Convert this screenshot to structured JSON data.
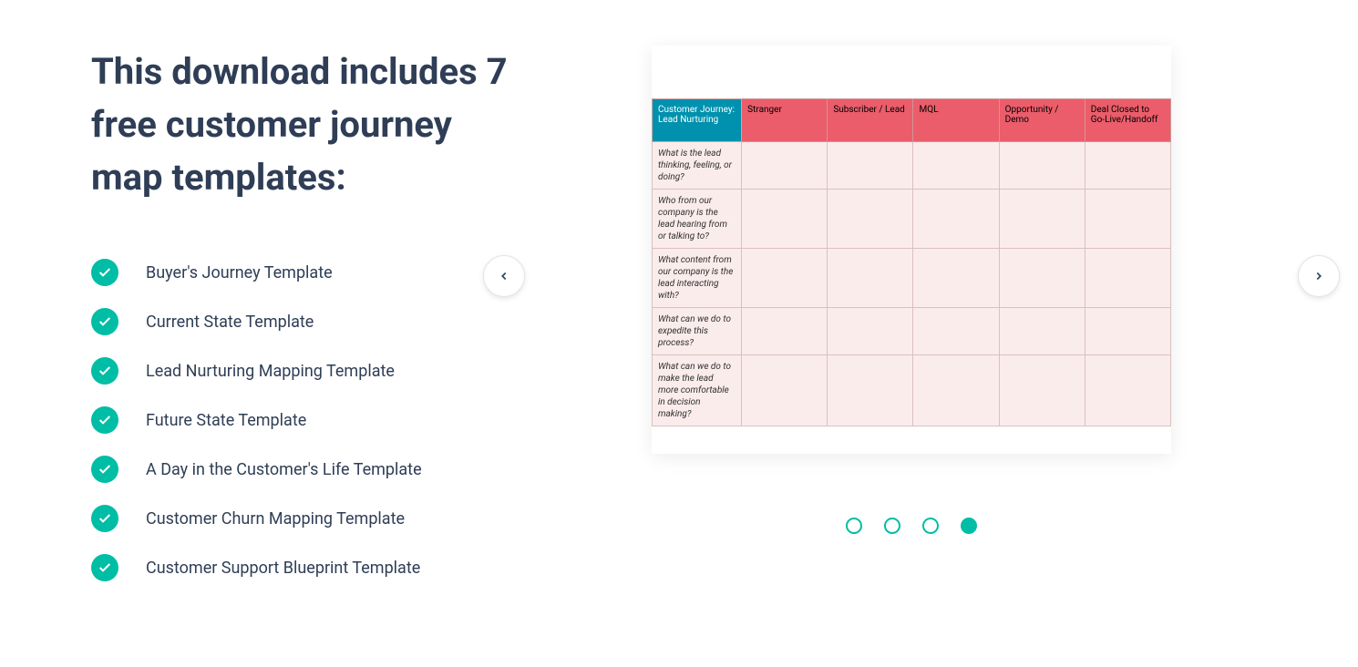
{
  "heading": "This download includes 7 free customer journey map templates:",
  "features": [
    "Buyer's Journey Template",
    "Current State Template",
    "Lead Nurturing Mapping Template",
    "Future State Template",
    "A Day in the Customer's Life Template",
    "Customer Churn Mapping Template",
    "Customer Support Blueprint Template"
  ],
  "preview": {
    "corner": "Customer Journey: Lead Nurturing",
    "columns": [
      "Stranger",
      "Subscriber / Lead",
      "MQL",
      "Opportunity / Demo",
      "Deal Closed to Go-Live/Handoff"
    ],
    "rows": [
      "What is the lead thinking, feeling, or doing?",
      "Who from our company is the lead hearing from or talking to?",
      "What content from our company is the lead interacting with?",
      "What can we do to expedite this process?",
      "What can we do to make the lead more comfortable in decision making?"
    ]
  },
  "carousel": {
    "total_dots": 4,
    "active_index": 3
  }
}
